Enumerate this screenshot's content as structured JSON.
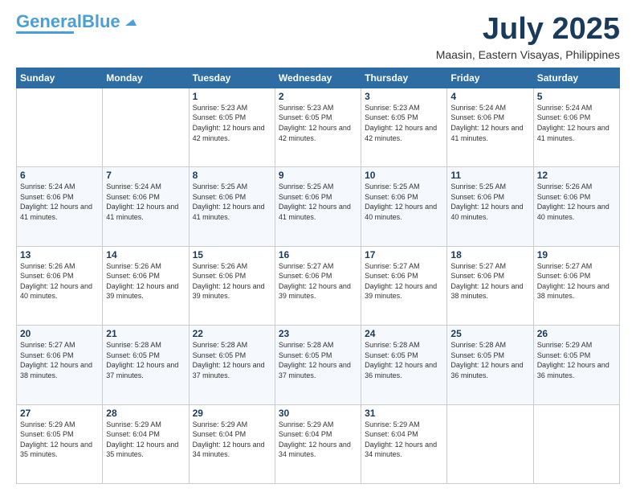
{
  "logo": {
    "text1": "General",
    "text2": "Blue"
  },
  "header": {
    "month": "July 2025",
    "location": "Maasin, Eastern Visayas, Philippines"
  },
  "weekdays": [
    "Sunday",
    "Monday",
    "Tuesday",
    "Wednesday",
    "Thursday",
    "Friday",
    "Saturday"
  ],
  "weeks": [
    [
      {
        "day": "",
        "info": ""
      },
      {
        "day": "",
        "info": ""
      },
      {
        "day": "1",
        "info": "Sunrise: 5:23 AM\nSunset: 6:05 PM\nDaylight: 12 hours and 42 minutes."
      },
      {
        "day": "2",
        "info": "Sunrise: 5:23 AM\nSunset: 6:05 PM\nDaylight: 12 hours and 42 minutes."
      },
      {
        "day": "3",
        "info": "Sunrise: 5:23 AM\nSunset: 6:05 PM\nDaylight: 12 hours and 42 minutes."
      },
      {
        "day": "4",
        "info": "Sunrise: 5:24 AM\nSunset: 6:06 PM\nDaylight: 12 hours and 41 minutes."
      },
      {
        "day": "5",
        "info": "Sunrise: 5:24 AM\nSunset: 6:06 PM\nDaylight: 12 hours and 41 minutes."
      }
    ],
    [
      {
        "day": "6",
        "info": "Sunrise: 5:24 AM\nSunset: 6:06 PM\nDaylight: 12 hours and 41 minutes."
      },
      {
        "day": "7",
        "info": "Sunrise: 5:24 AM\nSunset: 6:06 PM\nDaylight: 12 hours and 41 minutes."
      },
      {
        "day": "8",
        "info": "Sunrise: 5:25 AM\nSunset: 6:06 PM\nDaylight: 12 hours and 41 minutes."
      },
      {
        "day": "9",
        "info": "Sunrise: 5:25 AM\nSunset: 6:06 PM\nDaylight: 12 hours and 41 minutes."
      },
      {
        "day": "10",
        "info": "Sunrise: 5:25 AM\nSunset: 6:06 PM\nDaylight: 12 hours and 40 minutes."
      },
      {
        "day": "11",
        "info": "Sunrise: 5:25 AM\nSunset: 6:06 PM\nDaylight: 12 hours and 40 minutes."
      },
      {
        "day": "12",
        "info": "Sunrise: 5:26 AM\nSunset: 6:06 PM\nDaylight: 12 hours and 40 minutes."
      }
    ],
    [
      {
        "day": "13",
        "info": "Sunrise: 5:26 AM\nSunset: 6:06 PM\nDaylight: 12 hours and 40 minutes."
      },
      {
        "day": "14",
        "info": "Sunrise: 5:26 AM\nSunset: 6:06 PM\nDaylight: 12 hours and 39 minutes."
      },
      {
        "day": "15",
        "info": "Sunrise: 5:26 AM\nSunset: 6:06 PM\nDaylight: 12 hours and 39 minutes."
      },
      {
        "day": "16",
        "info": "Sunrise: 5:27 AM\nSunset: 6:06 PM\nDaylight: 12 hours and 39 minutes."
      },
      {
        "day": "17",
        "info": "Sunrise: 5:27 AM\nSunset: 6:06 PM\nDaylight: 12 hours and 39 minutes."
      },
      {
        "day": "18",
        "info": "Sunrise: 5:27 AM\nSunset: 6:06 PM\nDaylight: 12 hours and 38 minutes."
      },
      {
        "day": "19",
        "info": "Sunrise: 5:27 AM\nSunset: 6:06 PM\nDaylight: 12 hours and 38 minutes."
      }
    ],
    [
      {
        "day": "20",
        "info": "Sunrise: 5:27 AM\nSunset: 6:06 PM\nDaylight: 12 hours and 38 minutes."
      },
      {
        "day": "21",
        "info": "Sunrise: 5:28 AM\nSunset: 6:05 PM\nDaylight: 12 hours and 37 minutes."
      },
      {
        "day": "22",
        "info": "Sunrise: 5:28 AM\nSunset: 6:05 PM\nDaylight: 12 hours and 37 minutes."
      },
      {
        "day": "23",
        "info": "Sunrise: 5:28 AM\nSunset: 6:05 PM\nDaylight: 12 hours and 37 minutes."
      },
      {
        "day": "24",
        "info": "Sunrise: 5:28 AM\nSunset: 6:05 PM\nDaylight: 12 hours and 36 minutes."
      },
      {
        "day": "25",
        "info": "Sunrise: 5:28 AM\nSunset: 6:05 PM\nDaylight: 12 hours and 36 minutes."
      },
      {
        "day": "26",
        "info": "Sunrise: 5:29 AM\nSunset: 6:05 PM\nDaylight: 12 hours and 36 minutes."
      }
    ],
    [
      {
        "day": "27",
        "info": "Sunrise: 5:29 AM\nSunset: 6:05 PM\nDaylight: 12 hours and 35 minutes."
      },
      {
        "day": "28",
        "info": "Sunrise: 5:29 AM\nSunset: 6:04 PM\nDaylight: 12 hours and 35 minutes."
      },
      {
        "day": "29",
        "info": "Sunrise: 5:29 AM\nSunset: 6:04 PM\nDaylight: 12 hours and 34 minutes."
      },
      {
        "day": "30",
        "info": "Sunrise: 5:29 AM\nSunset: 6:04 PM\nDaylight: 12 hours and 34 minutes."
      },
      {
        "day": "31",
        "info": "Sunrise: 5:29 AM\nSunset: 6:04 PM\nDaylight: 12 hours and 34 minutes."
      },
      {
        "day": "",
        "info": ""
      },
      {
        "day": "",
        "info": ""
      }
    ]
  ]
}
